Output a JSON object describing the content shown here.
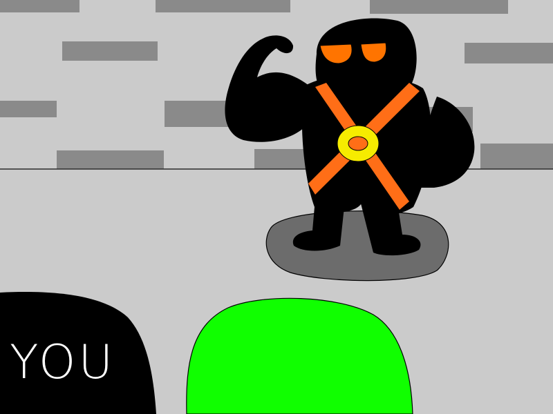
{
  "scene": {
    "player_label": "YOU"
  },
  "colors": {
    "wall": "#cbcbcb",
    "brick": "#8a8a8a",
    "floor": "#cbcbcb",
    "floor_line": "#2a2a2a",
    "shadow": "#6c6c6c",
    "enemy_body": "#000000",
    "enemy_eyes": "#ff7400",
    "harness": "#ff6e17",
    "buckle": "#f6ec00",
    "player_slime": "#10ff00",
    "player_hand": "#000000",
    "player_label": "#ffffff"
  }
}
